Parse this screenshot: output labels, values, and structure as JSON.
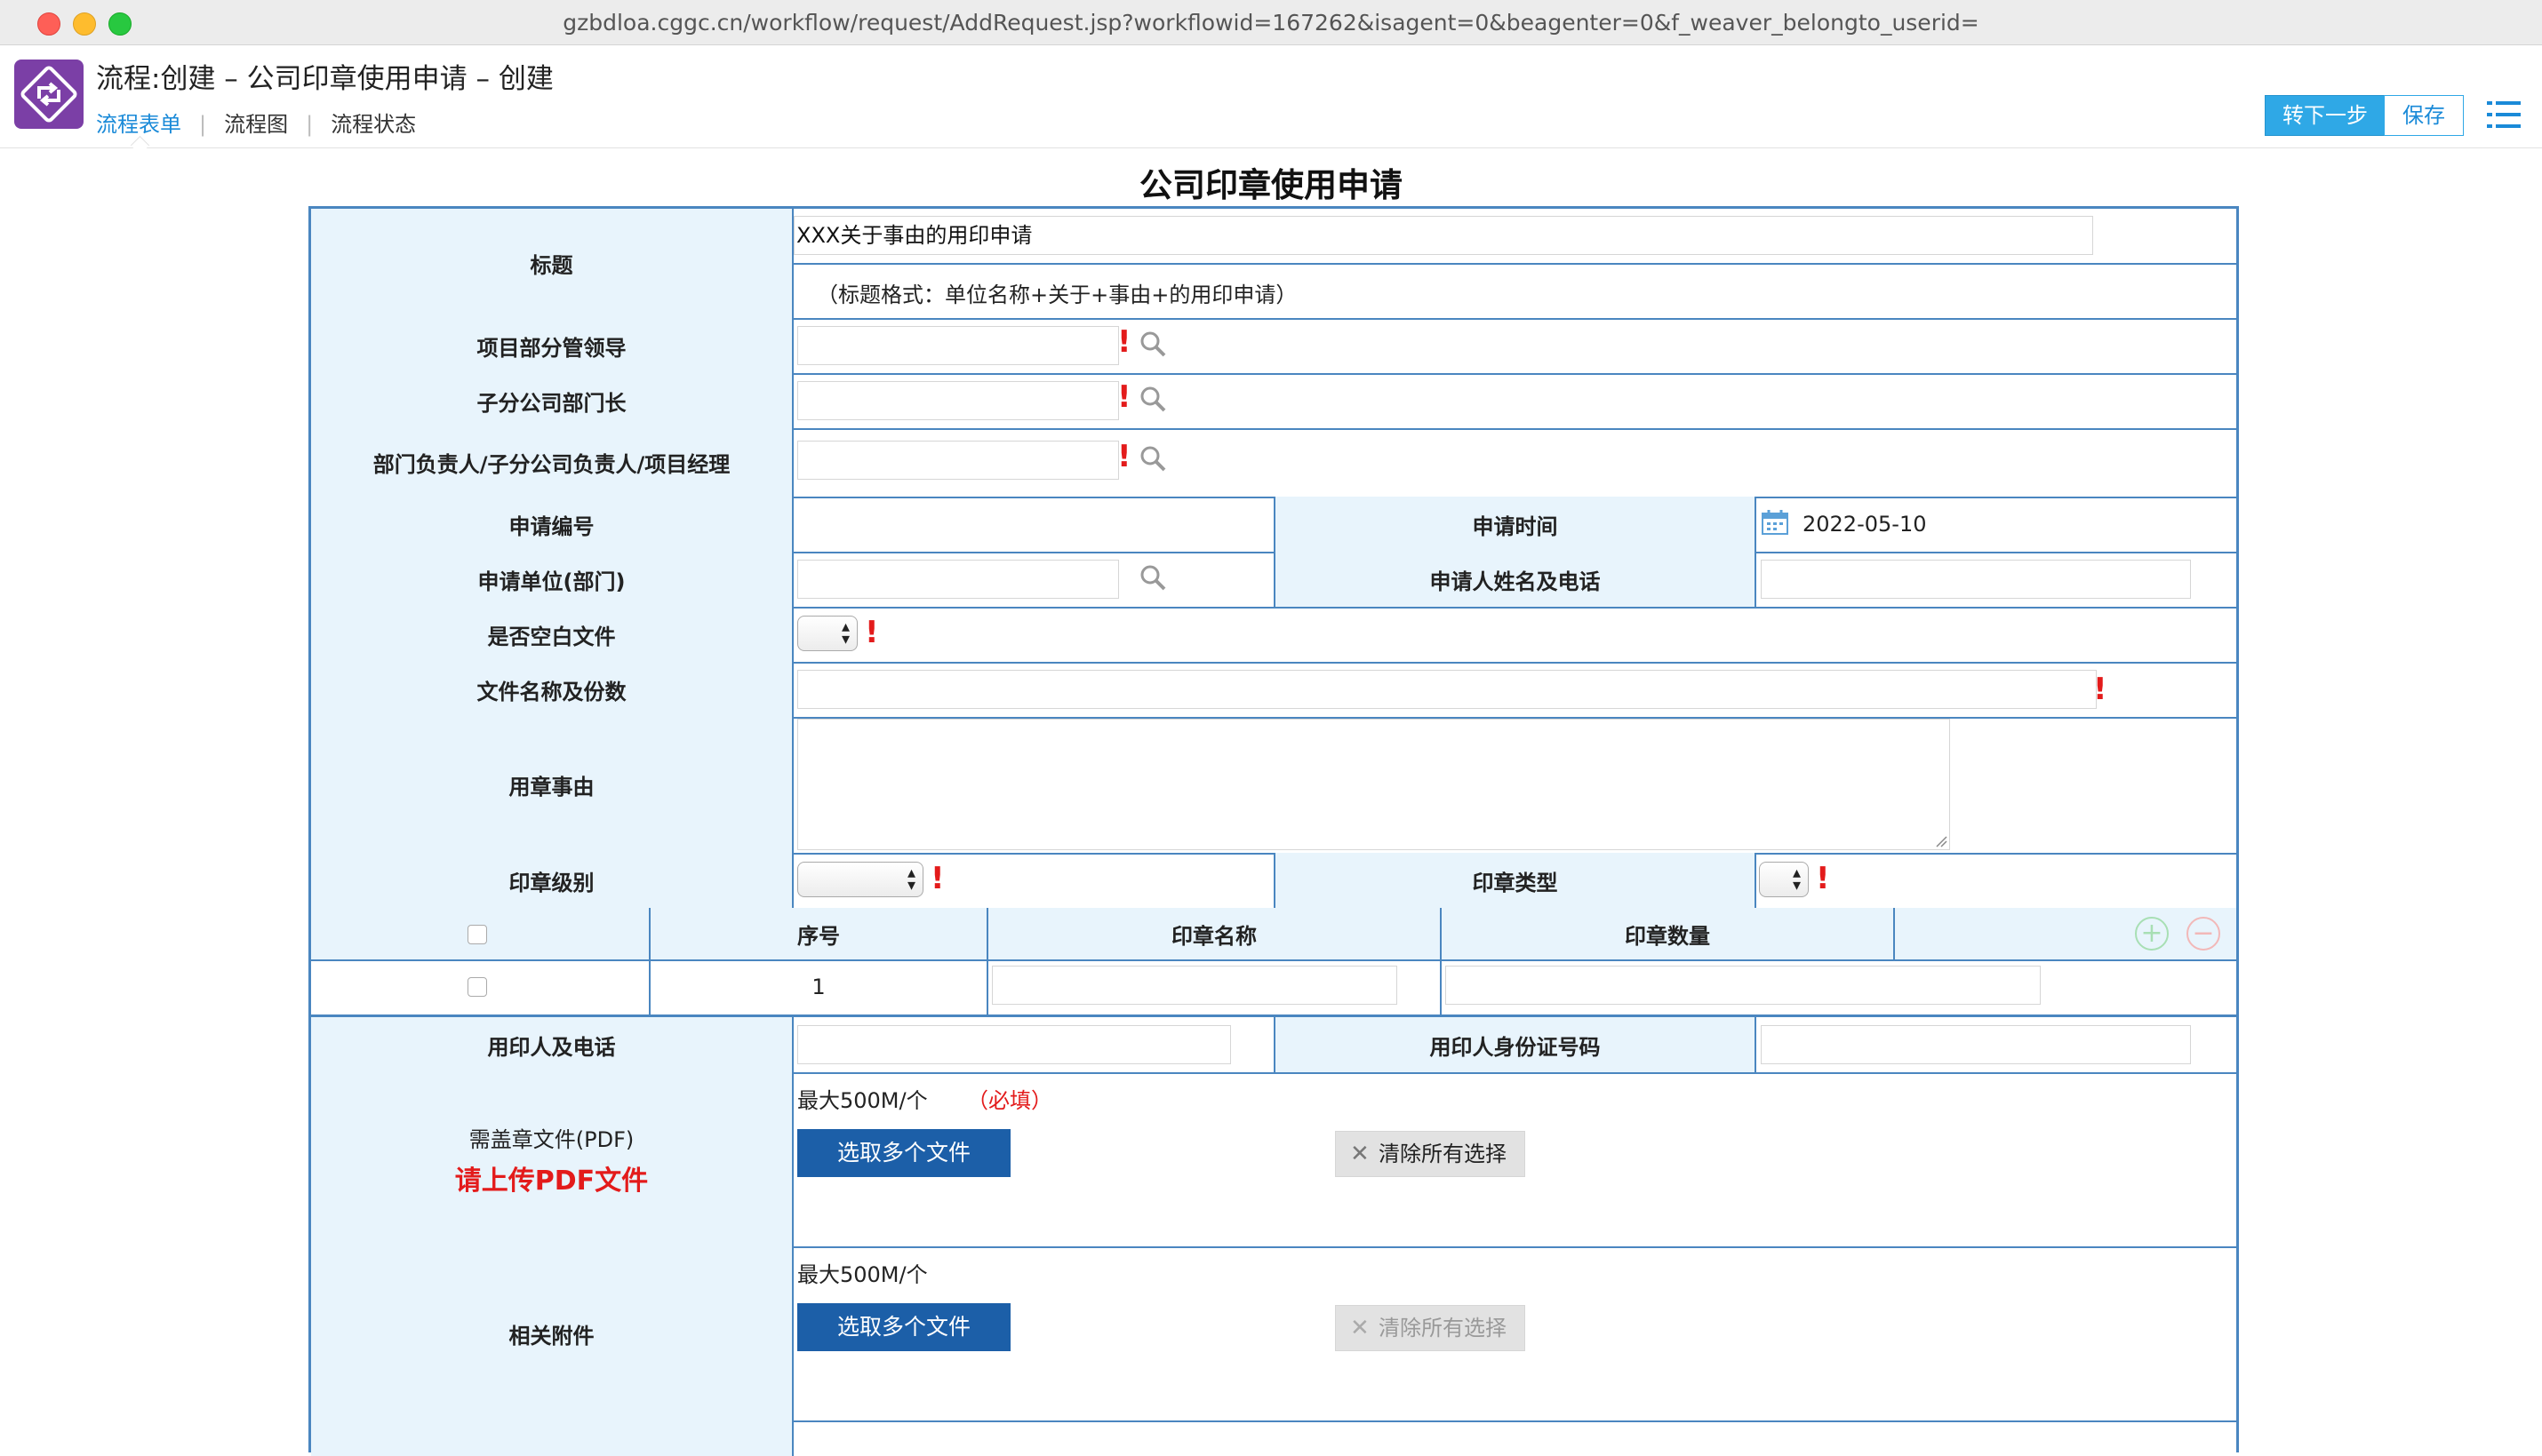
{
  "browser": {
    "url": "gzbdloa.cggc.cn/workflow/request/AddRequest.jsp?workflowid=167262&isagent=0&beagenter=0&f_weaver_belongto_userid="
  },
  "header": {
    "title": "流程:创建 – 公司印章使用申请 – 创建",
    "tabs": [
      "流程表单",
      "流程图",
      "流程状态"
    ],
    "next_label": "转下一步",
    "save_label": "保存",
    "logo_color": "#7b3fa6",
    "accent": "#2fa8e6"
  },
  "form": {
    "title": "公司印章使用申请",
    "labels": {
      "subject": "标题",
      "project_leader": "项目部分管领导",
      "branch_head": "子分公司部门长",
      "dept_head": "部门负责人/子分公司负责人/项目经理",
      "apply_no": "申请编号",
      "apply_time": "申请时间",
      "apply_unit": "申请单位(部门)",
      "applicant": "申请人姓名及电话",
      "blank_doc": "是否空白文件",
      "doc_name": "文件名称及份数",
      "reason": "用章事由",
      "seal_level": "印章级别",
      "seal_type": "印章类型",
      "user_phone": "用印人及电话",
      "user_id": "用印人身份证号码",
      "pdf_doc": "需盖章文件(PDF)",
      "pdf_note": "请上传PDF文件",
      "attachments": "相关附件"
    },
    "values": {
      "subject": "XXX关于事由的用印申请",
      "subject_hint": "（标题格式：单位名称+关于+事由+的用印申请）",
      "apply_time": "2022-05-10"
    },
    "subtable": {
      "headers": [
        "序号",
        "印章名称",
        "印章数量"
      ],
      "rows": [
        {
          "index": "1"
        }
      ]
    },
    "upload": {
      "max_size": "最大500M/个",
      "required": "（必填）",
      "select_label": "选取多个文件",
      "clear_label": "清除所有选择"
    },
    "colors": {
      "border": "#4a86c0",
      "label_bg": "#e8f4fc",
      "required": "#e31b1b",
      "upload_btn": "#1c5fa8"
    }
  }
}
